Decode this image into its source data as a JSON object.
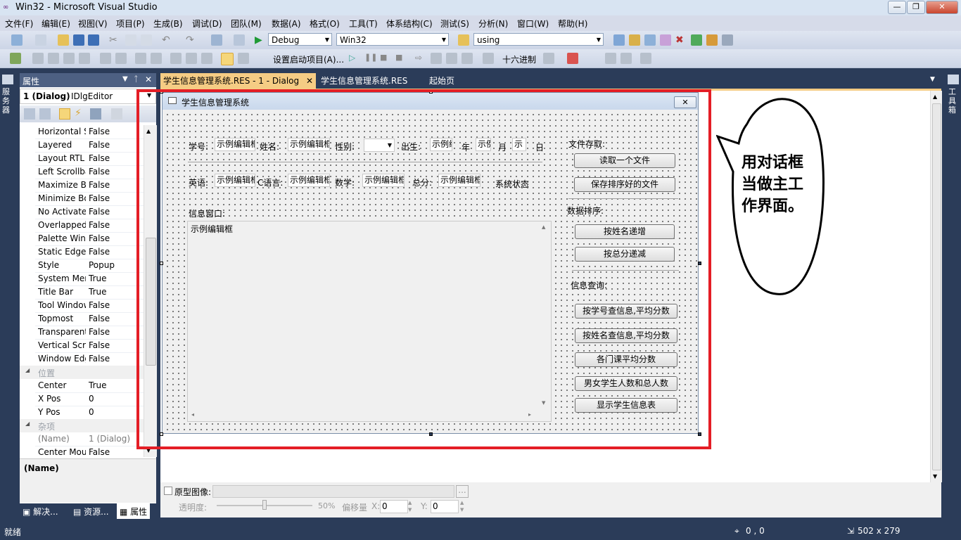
{
  "window": {
    "title": "Win32 - Microsoft Visual Studio",
    "logo": "vs-infinity-icon"
  },
  "menu": [
    "文件(F)",
    "编辑(E)",
    "视图(V)",
    "项目(P)",
    "生成(B)",
    "调试(D)",
    "团队(M)",
    "数据(A)",
    "格式(O)",
    "工具(T)",
    "体系结构(C)",
    "测试(S)",
    "分析(N)",
    "窗口(W)",
    "帮助(H)"
  ],
  "toolbar1": {
    "config": "Debug",
    "platform": "Win32",
    "find": "using"
  },
  "toolbar2": {
    "startup_project": "设置启动项目(A)...",
    "hex": "十六进制"
  },
  "left_strip": {
    "label": "服务器"
  },
  "right_strip": {
    "label": "工具箱"
  },
  "properties": {
    "title": "属性",
    "object_name": "1 (Dialog)",
    "object_type": "IDlgEditor",
    "rows": [
      {
        "k": "Horizontal S",
        "v": "False"
      },
      {
        "k": "Layered",
        "v": "False"
      },
      {
        "k": "Layout RTL",
        "v": "False"
      },
      {
        "k": "Left Scrollbar",
        "v": "False"
      },
      {
        "k": "Maximize Box",
        "v": "False"
      },
      {
        "k": "Minimize Box",
        "v": "False"
      },
      {
        "k": "No Activate",
        "v": "False"
      },
      {
        "k": "Overlapped",
        "v": "False"
      },
      {
        "k": "Palette Window",
        "v": "False"
      },
      {
        "k": "Static Edge",
        "v": "False"
      },
      {
        "k": "Style",
        "v": "Popup"
      },
      {
        "k": "System Menu",
        "v": "True"
      },
      {
        "k": "Title Bar",
        "v": "True"
      },
      {
        "k": "Tool Window",
        "v": "False"
      },
      {
        "k": "Topmost",
        "v": "False"
      },
      {
        "k": "Transparent",
        "v": "False"
      },
      {
        "k": "Vertical Scroll",
        "v": "False"
      },
      {
        "k": "Window Edge",
        "v": "False"
      }
    ],
    "cat_position": "位置",
    "pos_rows": [
      {
        "k": "Center",
        "v": "True"
      },
      {
        "k": "X Pos",
        "v": "0"
      },
      {
        "k": "Y Pos",
        "v": "0"
      }
    ],
    "cat_misc": "杂项",
    "misc_rows": [
      {
        "k": "(Name)",
        "v": "1 (Dialog)"
      },
      {
        "k": "Center Mouse",
        "v": "False"
      }
    ],
    "desc_title": "(Name)",
    "bottom_tabs": [
      "解决...",
      "资源...",
      "属性"
    ]
  },
  "tabs": [
    "学生信息管理系统.RES - 1 - Dialog",
    "学生信息管理系统.RES",
    "起始页"
  ],
  "dialog": {
    "title": "学生信息管理系统",
    "close": "✕",
    "row1": {
      "xh": "学号:",
      "xh_val": "示例编辑框",
      "xm": "姓名:",
      "xm_val": "示例编辑框",
      "xb": "性别:",
      "cs": "出生:",
      "cs_val": "示例编",
      "nian": "年",
      "m_val": "示例",
      "yue": "月",
      "d_val": "示",
      "ri": "日"
    },
    "row2": {
      "yy": "英语:",
      "yy_val": "示例编辑框",
      "c": "C语言:",
      "c_val": "示例编辑框",
      "sx": "数学:",
      "sx_val": "示例编辑框",
      "zf": "总分:",
      "zf_val": "示例编辑框",
      "status": "系统状态"
    },
    "info_label": "信息窗口:",
    "info_text": "示例编辑框",
    "file_group": "文件存取:",
    "btn_read": "读取一个文件",
    "btn_save": "保存排序好的文件",
    "sort_group": "数据排序:",
    "btn_sort_name": "按姓名递增",
    "btn_sort_total": "按总分递减",
    "query_group": "信息查询:",
    "btn_q_id": "按学号查信息,平均分数",
    "btn_q_name": "按姓名查信息,平均分数",
    "btn_course_avg": "各门课平均分数",
    "btn_gender_count": "男女学生人数和总人数",
    "btn_show_all": "显示学生信息表"
  },
  "callout": {
    "line1": "用对话框",
    "line2": "当做主工",
    "line3": "作界面。"
  },
  "proto": {
    "checkbox_label": "原型图像:",
    "browse": "...",
    "opacity_label": "透明度:",
    "opacity_value": "50%",
    "offset_label": "偏移量",
    "x_label": "X:",
    "x_value": "0",
    "y_label": "Y:",
    "y_value": "0"
  },
  "status": {
    "ready": "就绪",
    "position": "0 , 0",
    "size": "502 x 279"
  },
  "colors": {
    "highlight": "#e41e26",
    "chrome": "#2b3c59",
    "tab_active": "#f5cc84"
  }
}
